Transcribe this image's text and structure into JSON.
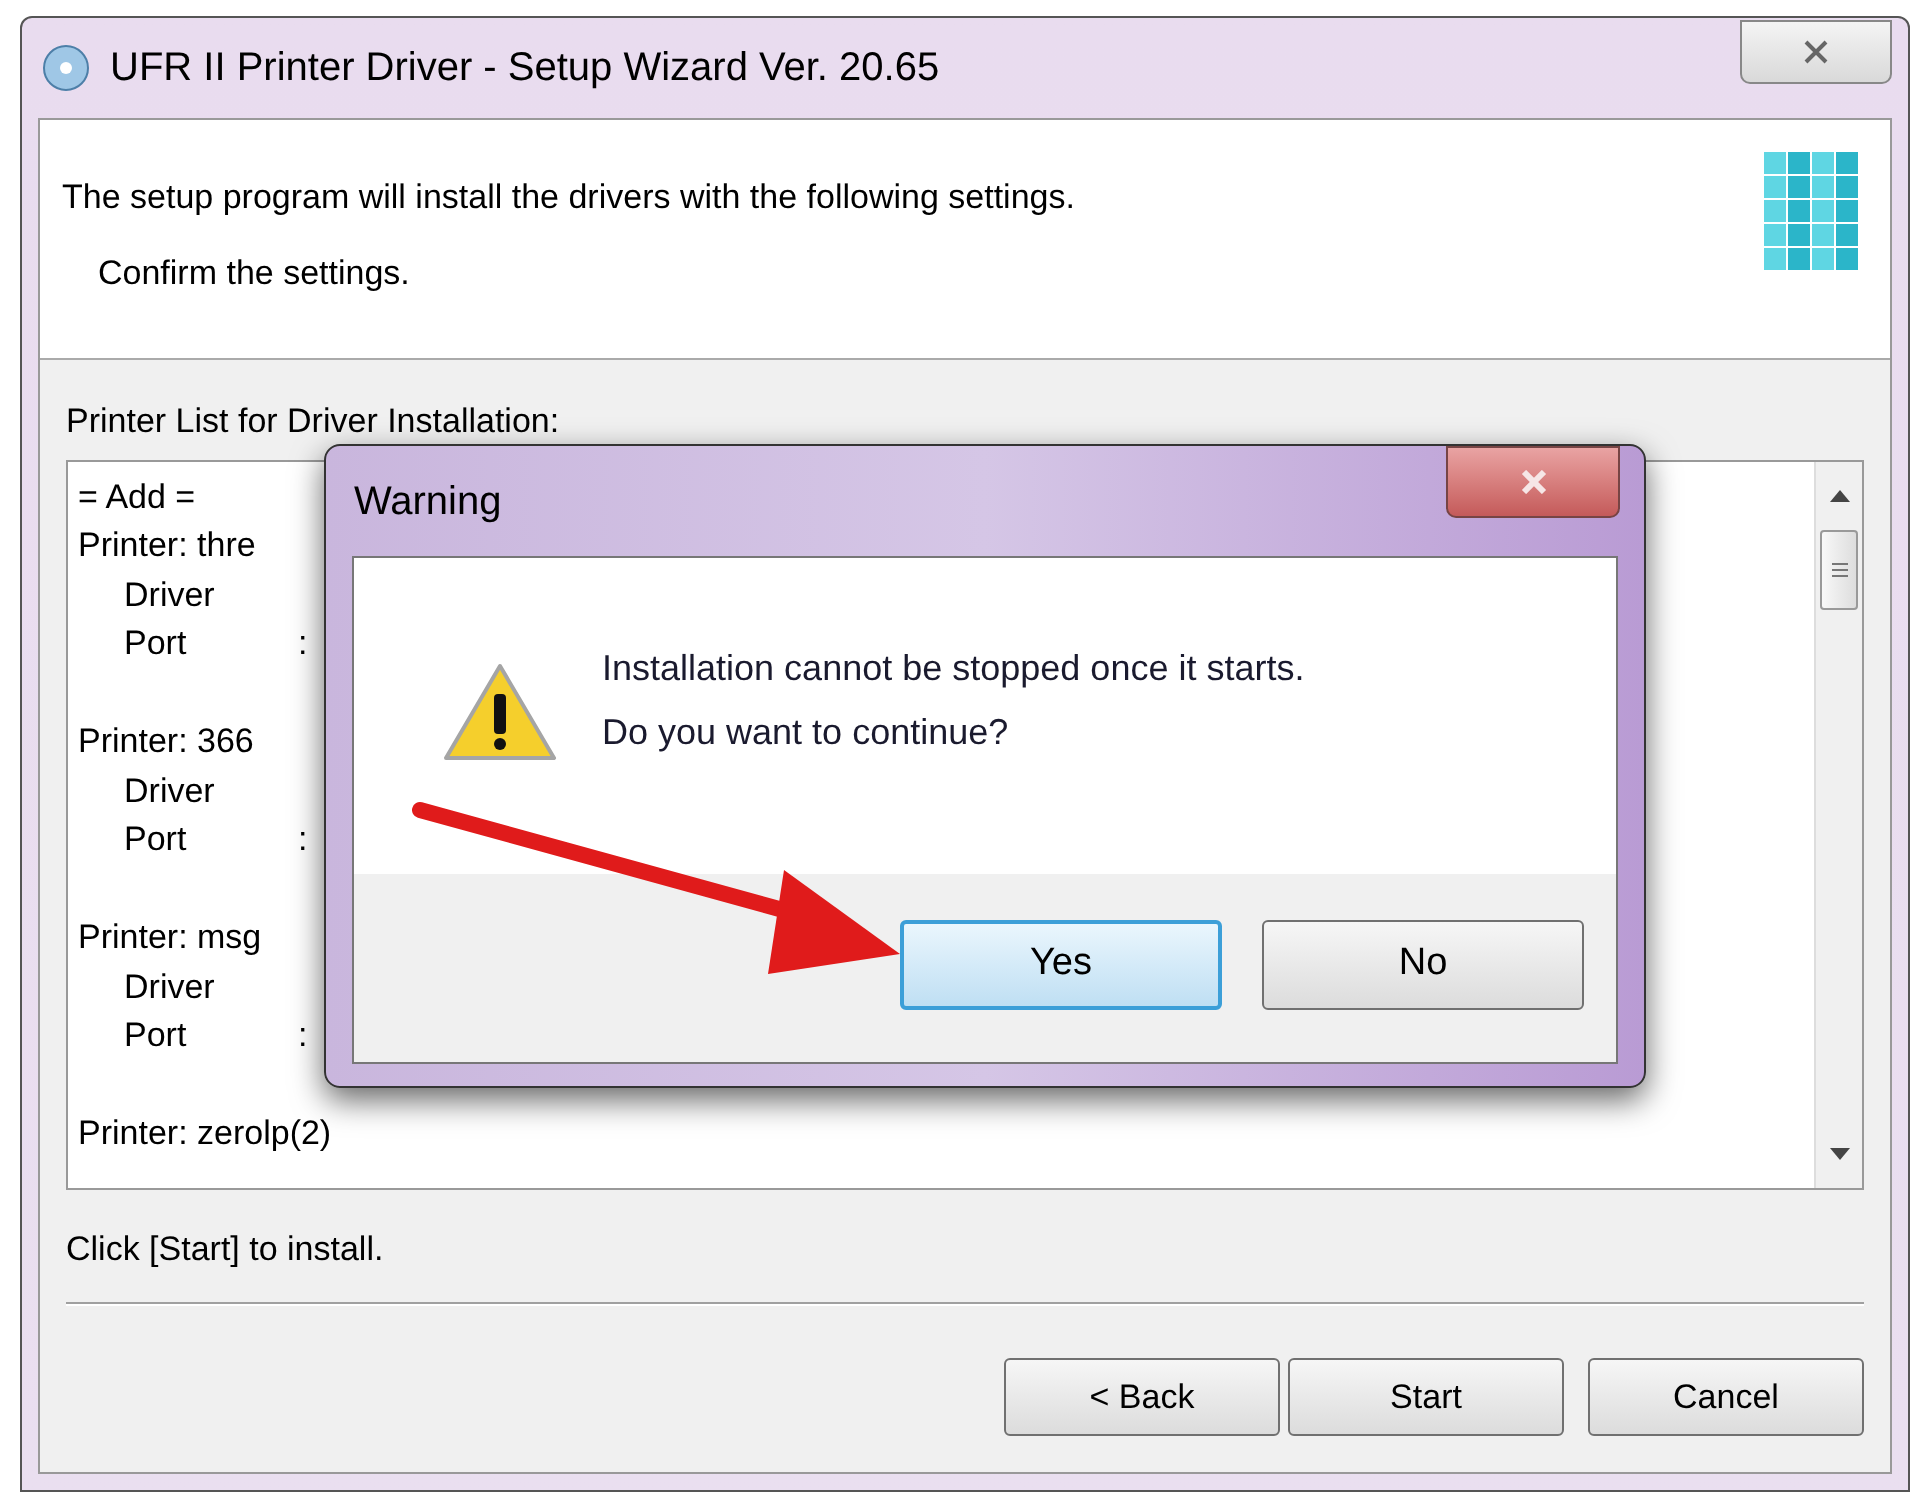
{
  "window": {
    "title": "UFR II Printer Driver - Setup Wizard Ver. 20.65"
  },
  "header": {
    "line_1": "The setup program will install the drivers with the following settings.",
    "line_2": "Confirm the settings."
  },
  "printer_list": {
    "label": "Printer List for Driver Installation:",
    "lines": [
      {
        "kind": "heading",
        "text": "= Add ="
      },
      {
        "kind": "heading",
        "text": "Printer: thre"
      },
      {
        "kind": "field",
        "text": "Driver"
      },
      {
        "kind": "field",
        "text": "Port",
        "sep": ":"
      },
      {
        "kind": "blank"
      },
      {
        "kind": "heading",
        "text": "Printer: 366"
      },
      {
        "kind": "field",
        "text": "Driver"
      },
      {
        "kind": "field",
        "text": "Port",
        "sep": ":"
      },
      {
        "kind": "blank"
      },
      {
        "kind": "heading",
        "text": "Printer: msg"
      },
      {
        "kind": "field",
        "text": "Driver"
      },
      {
        "kind": "field",
        "text": "Port",
        "sep": ":"
      },
      {
        "kind": "blank"
      },
      {
        "kind": "heading",
        "text": "Printer: zerolp(2)"
      }
    ]
  },
  "hint": "Click [Start] to install.",
  "buttons": [
    {
      "label": "< Back"
    },
    {
      "label": "Start"
    },
    {
      "label": "Cancel"
    }
  ],
  "dialog": {
    "title": "Warning",
    "message_1": "Installation cannot be stopped once it starts.",
    "message_2": "Do you want to continue?",
    "buttons": [
      {
        "label": "Yes",
        "selected": true
      },
      {
        "label": "No",
        "selected": false
      }
    ]
  }
}
